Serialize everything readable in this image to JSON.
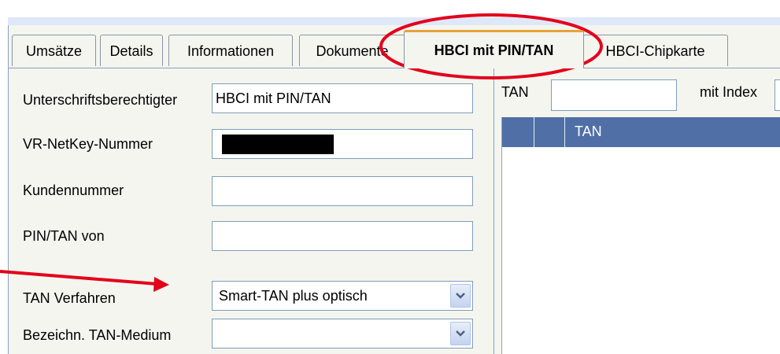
{
  "tabs": [
    {
      "label": "Umsätze"
    },
    {
      "label": "Details"
    },
    {
      "label": "Informationen"
    },
    {
      "label": "Dokumente"
    },
    {
      "label": "HBCI mit PIN/TAN",
      "active": true
    },
    {
      "label": "HBCI-Chipkarte"
    }
  ],
  "form": {
    "signatory_label": "Unterschriftsberechtigter",
    "signatory_value": "HBCI mit PIN/TAN",
    "netkey_label": "VR-NetKey-Nummer",
    "customer_label": "Kundennummer",
    "customer_value": "",
    "pintan_label": "PIN/TAN von",
    "pintan_value": "",
    "tan_method_label": "TAN Verfahren",
    "tan_method_value": "Smart-TAN plus optisch",
    "tan_medium_label": "Bezeichn. TAN-Medium",
    "tan_medium_value": ""
  },
  "tan_panel": {
    "tan_label": "TAN",
    "tan_value": "",
    "index_label": "mit Index",
    "grid_header": "TAN"
  },
  "colors": {
    "annotation_red": "#e3001b",
    "grid_header_blue": "#4f6fa6",
    "active_tab_accent": "#e7a238"
  }
}
